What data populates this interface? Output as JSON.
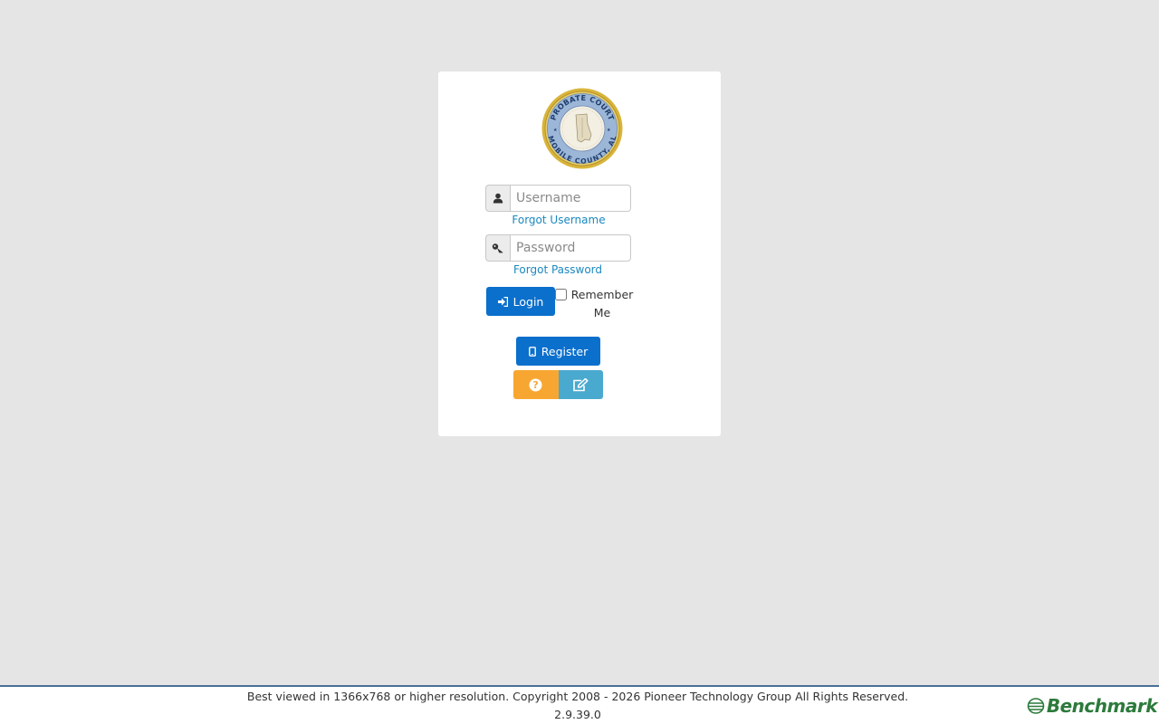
{
  "seal": {
    "top_text": "PROBATE COURT",
    "bottom_text": "MOBILE COUNTY, AL"
  },
  "login_form": {
    "username_placeholder": "Username",
    "forgot_username": "Forgot Username",
    "password_placeholder": "Password",
    "forgot_password": "Forgot Password",
    "login_label": "Login",
    "remember_me_line1": "Remember",
    "remember_me_line2": "Me",
    "register_label": "Register"
  },
  "footer": {
    "copyright": "Best viewed in 1366x768 or higher resolution. Copyright 2008 - 2026 Pioneer Technology Group All Rights Reserved.",
    "version": "2.9.39.0",
    "brand": "Benchmark"
  },
  "colors": {
    "background": "#e5e5e5",
    "primary": "#0b6fcc",
    "link": "#1a88c0",
    "help": "#f8a632",
    "edit": "#4aa9ce",
    "brand": "#2c7a3b"
  },
  "icons": {
    "username": "user-icon",
    "password": "key-icon",
    "login": "sign-in-icon",
    "register": "mobile-icon",
    "help": "question-circle-icon",
    "edit": "edit-icon"
  }
}
